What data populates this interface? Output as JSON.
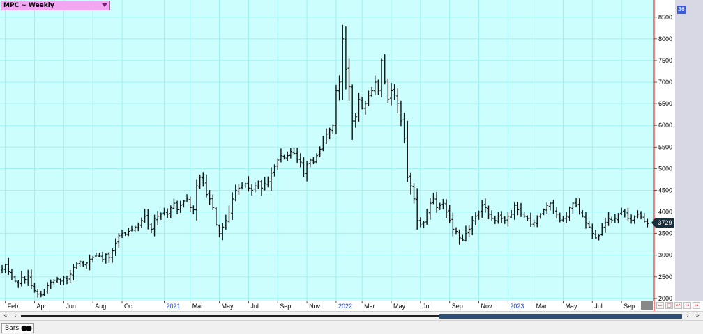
{
  "header": {
    "title": "MPC ~ Weekly",
    "badge": "36"
  },
  "price_tag": "3729",
  "colors": {
    "plot_bg": "#cdfefe",
    "grid": "#9ff0f0",
    "bar": "#111111",
    "accent_line": "#ff0000"
  },
  "footer": {
    "tab_label": "Bars"
  },
  "chart_data": {
    "type": "bar",
    "subtype": "ohlc",
    "ylim": [
      1950,
      8850
    ],
    "y_ticks": [
      2000,
      2500,
      3000,
      3500,
      4000,
      4500,
      5000,
      5500,
      6000,
      6500,
      7000,
      7500,
      8000,
      8500
    ],
    "x_ticks": [
      {
        "label": "Feb",
        "w": 1,
        "year": false
      },
      {
        "label": "Apr",
        "w": 10,
        "year": false
      },
      {
        "label": "Jun",
        "w": 19,
        "year": false
      },
      {
        "label": "Aug",
        "w": 28,
        "year": false
      },
      {
        "label": "Oct",
        "w": 37,
        "year": false
      },
      {
        "label": "2021",
        "w": 50,
        "year": true
      },
      {
        "label": "Mar",
        "w": 58,
        "year": false
      },
      {
        "label": "May",
        "w": 67,
        "year": false
      },
      {
        "label": "Jul",
        "w": 76,
        "year": false
      },
      {
        "label": "Sep",
        "w": 85,
        "year": false
      },
      {
        "label": "Nov",
        "w": 94,
        "year": false
      },
      {
        "label": "2022",
        "w": 103,
        "year": true
      },
      {
        "label": "Mar",
        "w": 111,
        "year": false
      },
      {
        "label": "May",
        "w": 120,
        "year": false
      },
      {
        "label": "Jul",
        "w": 129,
        "year": false
      },
      {
        "label": "Sep",
        "w": 138,
        "year": false
      },
      {
        "label": "Nov",
        "w": 147,
        "year": false
      },
      {
        "label": "2023",
        "w": 156,
        "year": true
      },
      {
        "label": "Mar",
        "w": 164,
        "year": false
      },
      {
        "label": "May",
        "w": 173,
        "year": false
      },
      {
        "label": "Jul",
        "w": 182,
        "year": false
      },
      {
        "label": "Sep",
        "w": 191,
        "year": false
      }
    ],
    "weekly_close": [
      2700,
      2780,
      2620,
      2520,
      2400,
      2360,
      2480,
      2440,
      2520,
      2300,
      2180,
      2100,
      2080,
      2150,
      2300,
      2380,
      2420,
      2450,
      2400,
      2480,
      2420,
      2560,
      2720,
      2800,
      2850,
      2780,
      2820,
      2900,
      2950,
      3000,
      2980,
      2900,
      3020,
      2950,
      3100,
      3280,
      3450,
      3500,
      3480,
      3550,
      3600,
      3650,
      3700,
      3800,
      3900,
      3700,
      3600,
      3850,
      3900,
      3950,
      4000,
      3950,
      4100,
      4200,
      4050,
      4150,
      4250,
      4300,
      4100,
      4050,
      4600,
      4800,
      4650,
      4400,
      4300,
      4100,
      3700,
      3500,
      3650,
      3800,
      4000,
      4300,
      4500,
      4550,
      4600,
      4650,
      4550,
      4500,
      4600,
      4700,
      4550,
      4650,
      4700,
      4900,
      5050,
      5200,
      5300,
      5250,
      5300,
      5400,
      5350,
      5200,
      5150,
      4900,
      5100,
      5200,
      5150,
      5300,
      5450,
      5600,
      5800,
      5900,
      6000,
      6800,
      7000,
      8000,
      7300,
      6900,
      6100,
      6200,
      6600,
      6400,
      6500,
      6700,
      6800,
      7000,
      6800,
      7500,
      7000,
      6600,
      6800,
      6700,
      6500,
      6100,
      5700,
      4800,
      4600,
      4300,
      3800,
      3700,
      3750,
      4000,
      4200,
      4300,
      4100,
      4150,
      4200,
      4000,
      3800,
      3600,
      3550,
      3400,
      3350,
      3500,
      3600,
      3800,
      3900,
      4000,
      4150,
      4100,
      3950,
      3850,
      3800,
      3900,
      3850,
      3800,
      3900,
      3950,
      4150,
      4050,
      3950,
      3900,
      3850,
      3700,
      3750,
      3900,
      3950,
      4050,
      4150,
      4200,
      4000,
      3950,
      3800,
      3850,
      3900,
      4100,
      4200,
      4150,
      4000,
      3900,
      3750,
      3650,
      3500,
      3400,
      3450,
      3650,
      3750,
      3850,
      3800,
      3850,
      3950,
      4000,
      3950,
      3850,
      3800,
      3900,
      3950,
      3880,
      3780,
      3729
    ]
  }
}
